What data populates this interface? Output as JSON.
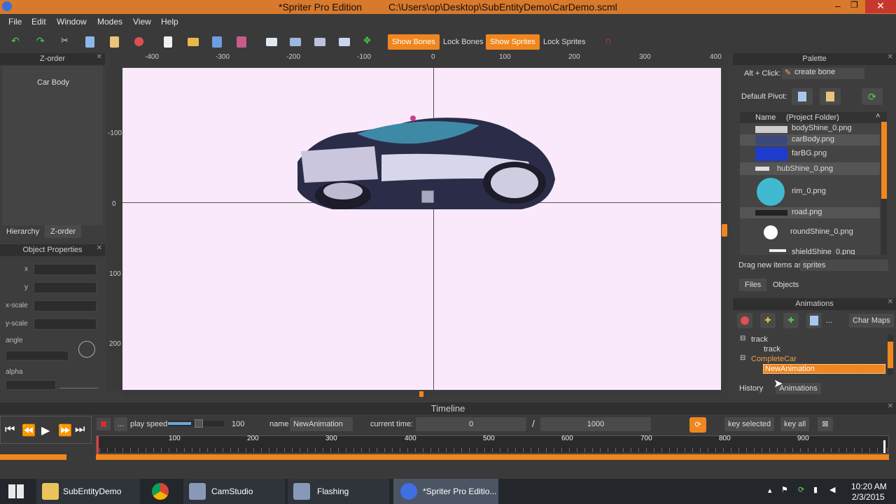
{
  "title": {
    "app": "*Spriter Pro Edition",
    "path": "C:\\Users\\op\\Desktop\\SubEntityDemo\\CarDemo.scml"
  },
  "menu": [
    "File",
    "Edit",
    "Window",
    "Modes",
    "View",
    "Help"
  ],
  "toolbar": {
    "show_bones": "Show Bones",
    "lock_bones": "Lock Bones",
    "show_sprites": "Show Sprites",
    "lock_sprites": "Lock Sprites"
  },
  "zorder": {
    "title": "Z-order",
    "item": "Car Body",
    "tab_hierarchy": "Hierarchy",
    "tab_zorder": "Z-order"
  },
  "props": {
    "title": "Object Properties",
    "x": "x",
    "y": "y",
    "xscale": "x-scale",
    "yscale": "y-scale",
    "angle": "angle",
    "alpha": "alpha"
  },
  "ruler": {
    "h": [
      "-400",
      "-300",
      "-200",
      "-100",
      "0",
      "100",
      "200",
      "300",
      "400"
    ],
    "v": [
      "-100",
      "0",
      "100",
      "200"
    ]
  },
  "palette": {
    "title": "Palette",
    "alt_click": "Alt + Click:",
    "create_bone": "create bone",
    "default_pivot": "Default Pivot:",
    "col_name": "Name",
    "col_folder": "(Project Folder)",
    "files": [
      "bodyShine_0.png",
      "carBody.png",
      "farBG.png",
      "hubShine_0.png",
      "rim_0.png",
      "road.png",
      "roundShine_0.png",
      "shieldShine_0.png"
    ],
    "drag_label": "Drag new items as",
    "drag_value": "sprites",
    "tab_files": "Files",
    "tab_objects": "Objects"
  },
  "animations": {
    "title": "Animations",
    "char_maps": "Char Maps",
    "ellipsis": "...",
    "entities": [
      {
        "name": "track",
        "anims": [
          "track"
        ]
      },
      {
        "name": "CompleteCar",
        "anims": [
          "NewAnimation"
        ]
      }
    ],
    "tab_history": "History",
    "tab_animations": "Animations"
  },
  "timeline": {
    "title": "Timeline",
    "play_speed_label": "play speed",
    "play_speed": "100",
    "name_label": "name",
    "name": "NewAnimation",
    "current_time_label": "current time:",
    "current_time": "0",
    "slash": "/",
    "length": "1000",
    "key_selected": "key selected",
    "key_all": "key all",
    "ellipsis": "...",
    "ticks": [
      "100",
      "200",
      "300",
      "400",
      "500",
      "600",
      "700",
      "800",
      "900"
    ]
  },
  "taskbar": {
    "items": [
      "SubEntityDemo",
      "CamStudio",
      "Flashing",
      "*Spriter Pro Editio..."
    ],
    "time": "10:20 AM",
    "date": "2/3/2015"
  },
  "colors": {
    "accent": "#f0861e",
    "canvas": "#f9e9fb",
    "titlebar": "#d8792c"
  }
}
